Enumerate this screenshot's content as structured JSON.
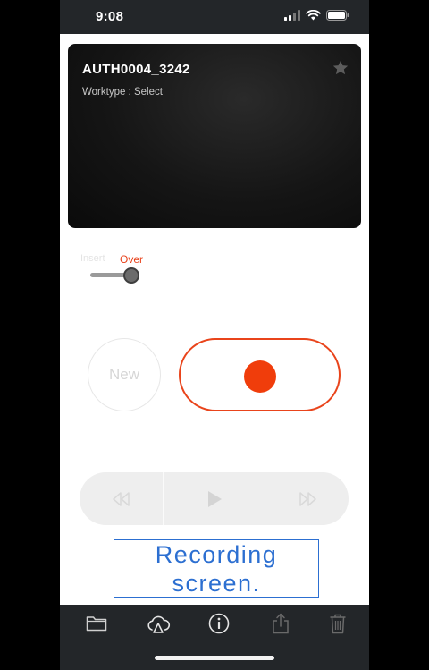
{
  "status_bar": {
    "time": "9:08"
  },
  "card": {
    "title": "AUTH0004_3242",
    "worktype": "Worktype : Select"
  },
  "mode": {
    "insert_label": "Insert",
    "over_label": "Over",
    "selected": "Over"
  },
  "controls": {
    "new_label": "New"
  },
  "caption": {
    "line1": "Recording",
    "line2": "screen."
  },
  "colors": {
    "accent": "#f03d0b",
    "caption_blue": "#2c6fd1",
    "bar_dark": "#232629"
  },
  "toolbar": {
    "icons": [
      "folder-icon",
      "cloud-upload-icon",
      "info-icon",
      "share-icon",
      "trash-icon"
    ]
  }
}
